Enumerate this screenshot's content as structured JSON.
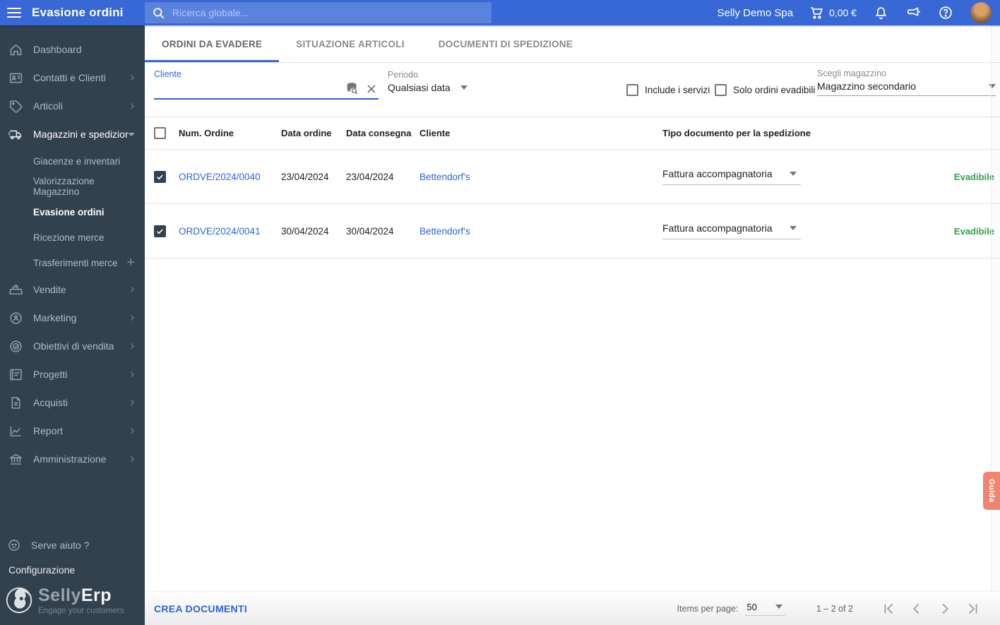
{
  "topbar": {
    "title": "Evasione ordini",
    "search_placeholder": "Ricerca globale...",
    "company": "Selly Demo Spa",
    "cart_total": "0,00 €"
  },
  "sidebar": {
    "items": [
      {
        "label": "Dashboard",
        "icon": "home-icon",
        "expandable": false
      },
      {
        "label": "Contatti e Clienti",
        "icon": "contacts-icon",
        "expandable": true
      },
      {
        "label": "Articoli",
        "icon": "tag-icon",
        "expandable": true
      },
      {
        "label": "Magazzini e spedizion",
        "icon": "truck-icon",
        "expanded": true
      },
      {
        "label": "Vendite",
        "icon": "cash-register-icon",
        "expandable": true
      },
      {
        "label": "Marketing",
        "icon": "marketing-icon",
        "expandable": true
      },
      {
        "label": "Obiettivi di vendita",
        "icon": "target-icon",
        "expandable": true
      },
      {
        "label": "Progetti",
        "icon": "projects-icon",
        "expandable": true
      },
      {
        "label": "Acquisti",
        "icon": "document-icon",
        "expandable": true
      },
      {
        "label": "Report",
        "icon": "chart-icon",
        "expandable": true
      },
      {
        "label": "Amministrazione",
        "icon": "bank-icon",
        "expandable": true
      }
    ],
    "warehouse_subitems": [
      {
        "label": "Giacenze e inventari",
        "active": false
      },
      {
        "label": "Valorizzazione Magazzino",
        "active": false
      },
      {
        "label": "Evasione ordini",
        "active": true
      },
      {
        "label": "Ricezione merce",
        "active": false
      },
      {
        "label": "Trasferimenti merce",
        "active": false,
        "has_plus": true
      }
    ],
    "help_label": "Serve aiuto ?",
    "config_label": "Configurazione",
    "logo_selly": "Selly",
    "logo_erp": "Erp",
    "logo_tagline": "Engage your customers"
  },
  "tabs": [
    {
      "label": "ORDINI DA EVADERE",
      "active": true
    },
    {
      "label": "SITUAZIONE ARTICOLI",
      "active": false
    },
    {
      "label": "DOCUMENTI DI SPEDIZIONE",
      "active": false
    }
  ],
  "filters": {
    "cliente_label": "Cliente",
    "cliente_value": "",
    "periodo_label": "Periodo",
    "periodo_value": "Qualsiasi data",
    "include_servizi_label": "Include i servizi",
    "include_servizi_checked": false,
    "solo_ordini_label": "Solo ordini evadibili",
    "solo_ordini_checked": false,
    "magazzino_label": "Scegli magazzino",
    "magazzino_value": "Magazzino secondario"
  },
  "table": {
    "select_all_checked": false,
    "headers": {
      "order_number": "Num. Ordine",
      "order_date": "Data ordine",
      "delivery_date": "Data consegna",
      "customer": "Cliente",
      "document_type": "Tipo documento per la spedizione"
    },
    "rows": [
      {
        "checked": true,
        "order_number": "ORDVE/2024/0040",
        "order_date": "23/04/2024",
        "delivery_date": "23/04/2024",
        "customer": "Bettendorf's",
        "document_type": "Fattura accompagnatoria",
        "status": "Evadibile"
      },
      {
        "checked": true,
        "order_number": "ORDVE/2024/0041",
        "order_date": "30/04/2024",
        "delivery_date": "30/04/2024",
        "customer": "Bettendorf's",
        "document_type": "Fattura accompagnatoria",
        "status": "Evadibile"
      }
    ]
  },
  "footer": {
    "create_button": "CREA DOCUMENTI",
    "items_per_page_label": "Items per page:",
    "items_per_page_value": "50",
    "range": "1 – 2 of 2"
  },
  "guide_tab": {
    "label": "Guida"
  },
  "colors": {
    "topbar_blue": "#3768D5",
    "sidebar_bg": "#32414E",
    "link_blue": "#2C63D8",
    "status_green": "#2FA04C",
    "guide_tab_bg": "#F0846E"
  }
}
